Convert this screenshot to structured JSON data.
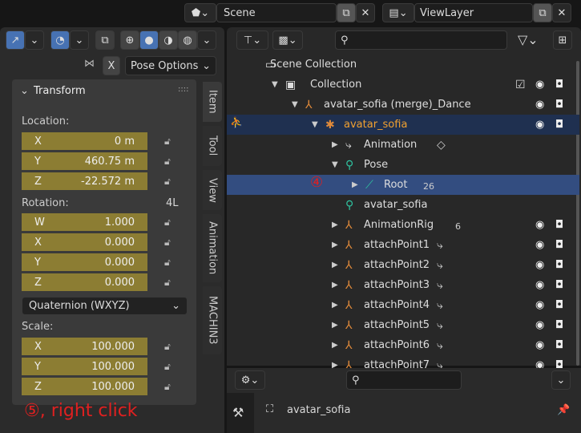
{
  "topbar": {
    "scene": "Scene",
    "view_layer": "ViewLayer"
  },
  "viewport": {
    "pose_options": "Pose Options",
    "x_mirror": "X"
  },
  "npanel": {
    "transform_title": "Transform",
    "location_label": "Location:",
    "location": [
      {
        "axis": "X",
        "value": "0 m"
      },
      {
        "axis": "Y",
        "value": "460.75 m"
      },
      {
        "axis": "Z",
        "value": "-22.572 m"
      }
    ],
    "rotation_label": "Rotation:",
    "rotation_lock": "4L",
    "rotation": [
      {
        "axis": "W",
        "value": "1.000"
      },
      {
        "axis": "X",
        "value": "0.000"
      },
      {
        "axis": "Y",
        "value": "0.000"
      },
      {
        "axis": "Z",
        "value": "0.000"
      }
    ],
    "rotation_mode": "Quaternion (WXYZ)",
    "scale_label": "Scale:",
    "scale": [
      {
        "axis": "X",
        "value": "100.000"
      },
      {
        "axis": "Y",
        "value": "100.000"
      },
      {
        "axis": "Z",
        "value": "100.000"
      }
    ],
    "tabs": [
      "Item",
      "Tool",
      "View",
      "Animation",
      "MACHIN3"
    ]
  },
  "annotations": {
    "step4": "④",
    "step5": "⑤, right click"
  },
  "outliner": {
    "rows": [
      {
        "label": "Scene Collection",
        "level": 0,
        "icon": "scene-collection-icon",
        "arrow": "",
        "vis": false
      },
      {
        "label": "Collection",
        "level": 1,
        "icon": "collection-icon",
        "arrow": "▼",
        "vis": true,
        "check": true
      },
      {
        "label": "avatar_sofia (merge)_Dance",
        "level": 2,
        "icon": "armature-icon",
        "arrow": "▼",
        "vis": true
      },
      {
        "label": "avatar_sofia",
        "level": 3,
        "icon": "armature-object-icon",
        "arrow": "▼",
        "vis": true,
        "active": true
      },
      {
        "label": "Animation",
        "level": 4,
        "icon": "action-icon",
        "arrow": "▶",
        "vis": false,
        "extra": "keyframe-icon"
      },
      {
        "label": "Pose",
        "level": 4,
        "icon": "pose-icon",
        "arrow": "▼",
        "vis": false
      },
      {
        "label": "Root",
        "level": 5,
        "icon": "bone-icon",
        "arrow": "▶",
        "vis": false,
        "selected": true,
        "badge": "26"
      },
      {
        "label": "avatar_sofia",
        "level": 4,
        "icon": "armature-data-icon",
        "arrow": "",
        "vis": false
      },
      {
        "label": "AnimationRig",
        "level": 4,
        "icon": "armature-icon",
        "arrow": "▶",
        "vis": true,
        "badge": "6"
      },
      {
        "label": "attachPoint1",
        "level": 4,
        "icon": "armature-icon",
        "arrow": "▶",
        "vis": true,
        "extra": "action-icon"
      },
      {
        "label": "attachPoint2",
        "level": 4,
        "icon": "armature-icon",
        "arrow": "▶",
        "vis": true,
        "extra": "action-icon"
      },
      {
        "label": "attachPoint3",
        "level": 4,
        "icon": "armature-icon",
        "arrow": "▶",
        "vis": true,
        "extra": "action-icon"
      },
      {
        "label": "attachPoint4",
        "level": 4,
        "icon": "armature-icon",
        "arrow": "▶",
        "vis": true,
        "extra": "action-icon"
      },
      {
        "label": "attachPoint5",
        "level": 4,
        "icon": "armature-icon",
        "arrow": "▶",
        "vis": true,
        "extra": "action-icon"
      },
      {
        "label": "attachPoint6",
        "level": 4,
        "icon": "armature-icon",
        "arrow": "▶",
        "vis": true,
        "extra": "action-icon"
      },
      {
        "label": "attachPoint7",
        "level": 4,
        "icon": "armature-icon",
        "arrow": "▶",
        "vis": true,
        "extra": "action-icon"
      }
    ]
  },
  "properties": {
    "object_name": "avatar_sofia"
  },
  "colors": {
    "accent": "#4772b3",
    "active_text": "#f0a030",
    "field": "#8c7d33",
    "annotation": "#e02020"
  }
}
